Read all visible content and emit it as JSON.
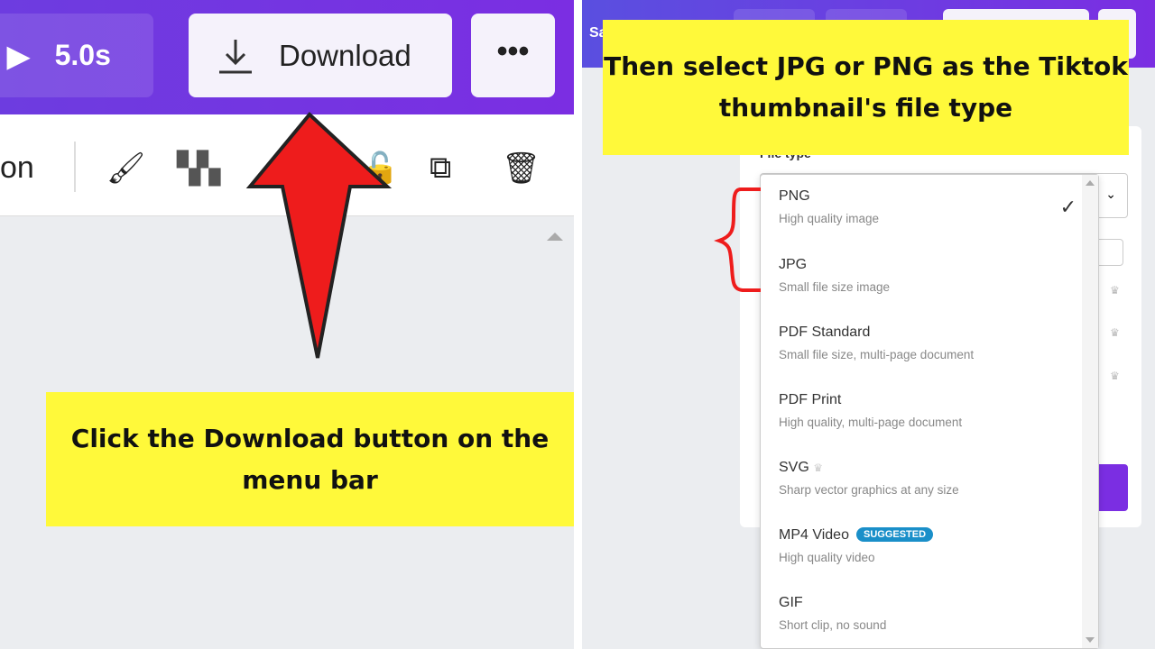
{
  "left": {
    "duration": "5.0s",
    "download_label": "Download",
    "more_label": "•••",
    "toolbar_partial": "on",
    "caption": "Click the Download button on the menu bar"
  },
  "right": {
    "partial_title": "Sa",
    "file_type_label": "File type",
    "caption": "Then select JPG or PNG as the Tiktok thumbnail's file type",
    "options": [
      {
        "name": "PNG",
        "desc": "High quality image",
        "selected": true
      },
      {
        "name": "JPG",
        "desc": "Small file size image"
      },
      {
        "name": "PDF Standard",
        "desc": "Small file size, multi-page document"
      },
      {
        "name": "PDF Print",
        "desc": "High quality, multi-page document"
      },
      {
        "name": "SVG",
        "desc": "Sharp vector graphics at any size",
        "premium": true
      },
      {
        "name": "MP4 Video",
        "desc": "High quality video",
        "badge": "SUGGESTED"
      },
      {
        "name": "GIF",
        "desc": "Short clip, no sound"
      }
    ]
  },
  "colors": {
    "accent": "#7b2ee2",
    "arrow": "#ee1c1c",
    "caption_bg": "#fff93a"
  }
}
